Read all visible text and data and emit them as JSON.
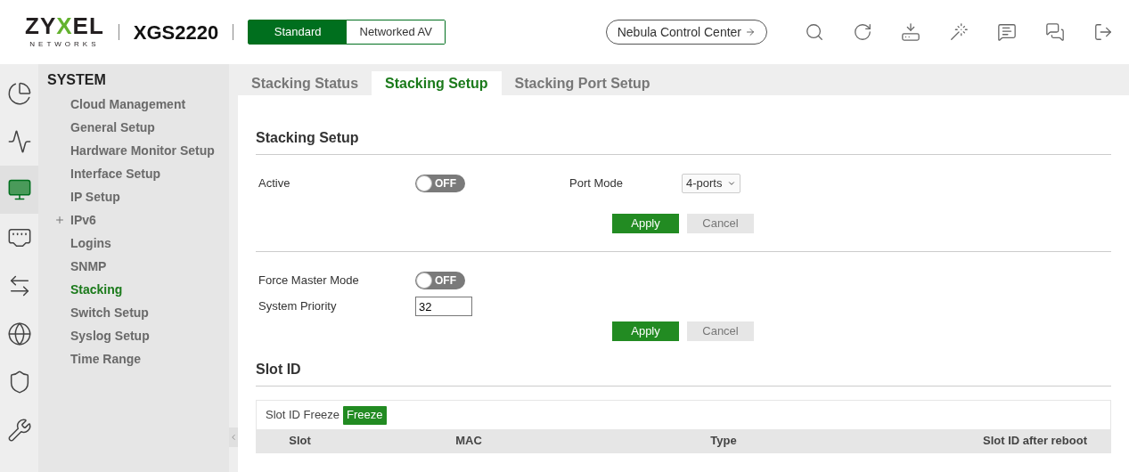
{
  "logo": {
    "parts": [
      {
        "text": "ZY",
        "color": "#231f20"
      },
      {
        "text": "X",
        "color": "#64b22f"
      },
      {
        "text": "EL",
        "color": "#231f20"
      }
    ],
    "sub": "NETWORKS"
  },
  "model": "XGS2220",
  "modes": [
    {
      "label": "Standard",
      "selected": true
    },
    {
      "label": "Networked AV",
      "selected": false
    }
  ],
  "nebula_button": "Nebula Control Center",
  "rail": [
    {
      "selected": false
    },
    {
      "selected": false
    },
    {
      "selected": true
    },
    {
      "selected": false
    },
    {
      "selected": false
    },
    {
      "selected": false
    },
    {
      "selected": false
    },
    {
      "selected": false
    }
  ],
  "sidebar": {
    "title": "SYSTEM",
    "items": [
      {
        "label": "Cloud Management",
        "selected": false
      },
      {
        "label": "General Setup",
        "selected": false
      },
      {
        "label": "Hardware Monitor Setup",
        "selected": false
      },
      {
        "label": "Interface Setup",
        "selected": false
      },
      {
        "label": "IP Setup",
        "selected": false
      },
      {
        "label": "IPv6",
        "selected": false,
        "expanded": false
      },
      {
        "label": "Logins",
        "selected": false
      },
      {
        "label": "SNMP",
        "selected": false
      },
      {
        "label": "Stacking",
        "selected": true
      },
      {
        "label": "Switch Setup",
        "selected": false
      },
      {
        "label": "Syslog Setup",
        "selected": false
      },
      {
        "label": "Time Range",
        "selected": false
      }
    ]
  },
  "tabs": [
    {
      "label": "Stacking Status",
      "selected": false
    },
    {
      "label": "Stacking Setup",
      "selected": true
    },
    {
      "label": "Stacking Port Setup",
      "selected": false
    }
  ],
  "stacking_setup": {
    "title": "Stacking Setup",
    "active": {
      "label": "Active",
      "on": false,
      "text": "OFF"
    },
    "port_mode": {
      "label": "Port Mode",
      "value": "4-ports"
    },
    "buttons": [
      "Apply",
      "Cancel"
    ],
    "force_master": {
      "label": "Force Master Mode",
      "on": false,
      "text": "OFF"
    },
    "priority": {
      "label": "System Priority",
      "value": "32"
    },
    "buttons_2": [
      "Apply",
      "Cancel"
    ]
  },
  "slot_id": {
    "title": "Slot ID",
    "freeze_label": "Slot ID Freeze",
    "freeze_button": "Freeze",
    "columns": [
      "Slot",
      "MAC",
      "Type",
      "Slot ID after reboot"
    ]
  }
}
